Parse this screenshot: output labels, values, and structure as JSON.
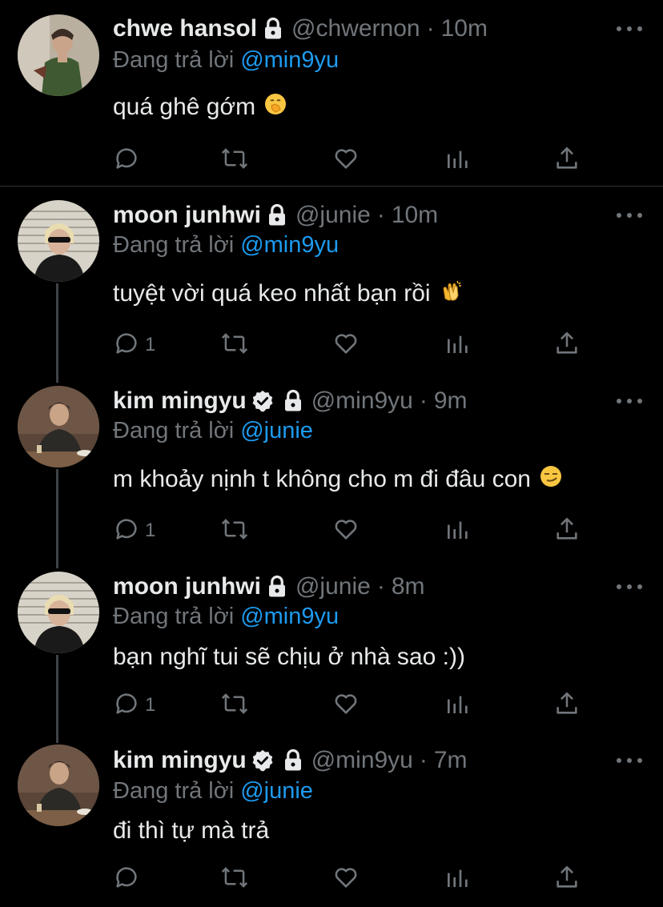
{
  "colors": {
    "background": "#000000",
    "text": "#e7e9ea",
    "muted": "#71767b",
    "link": "#1d9bf0",
    "thread_line": "#3f4246"
  },
  "labels": {
    "replying_to": "Đang trả lời",
    "separator": "·"
  },
  "tweets": [
    {
      "name": "chwe hansol",
      "verified": false,
      "locked": true,
      "handle": "@chwernon",
      "time": "10m",
      "reply_to": "@min9yu",
      "text": "quá ghê gớm",
      "emoji": "face-with-hand-over-mouth",
      "replies": "",
      "avatar": "avatar-chwernon"
    },
    {
      "name": "moon junhwi",
      "verified": false,
      "locked": true,
      "handle": "@junie",
      "time": "10m",
      "reply_to": "@min9yu",
      "text": "tuyệt vời quá keo nhất bạn rồi",
      "emoji": "clapping-hands",
      "replies": "1",
      "avatar": "avatar-junie"
    },
    {
      "name": "kim mingyu",
      "verified": true,
      "locked": true,
      "handle": "@min9yu",
      "time": "9m",
      "reply_to": "@junie",
      "text": "m khoảy nịnh t không cho m đi đâu con",
      "emoji": "smirking-face",
      "replies": "1",
      "avatar": "avatar-min9yu"
    },
    {
      "name": "moon junhwi",
      "verified": false,
      "locked": true,
      "handle": "@junie",
      "time": "8m",
      "reply_to": "@min9yu",
      "text": "bạn nghĩ tui sẽ chịu ở nhà sao :))",
      "emoji": "",
      "replies": "1",
      "avatar": "avatar-junie"
    },
    {
      "name": "kim mingyu",
      "verified": true,
      "locked": true,
      "handle": "@min9yu",
      "time": "7m",
      "reply_to": "@junie",
      "text": "đi thì tự mà trả",
      "emoji": "",
      "replies": "",
      "avatar": "avatar-min9yu"
    }
  ]
}
